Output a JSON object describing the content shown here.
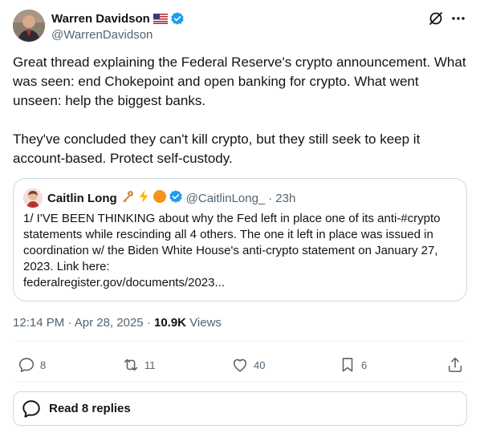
{
  "post": {
    "author_name": "Warren Davidson",
    "author_flag": "🇺🇸",
    "author_handle": "@WarrenDavidson",
    "paragraph_1": "Great thread explaining the Federal Reserve's crypto announcement. What was seen: end Chokepoint and open banking for crypto. What went unseen: help the biggest banks.",
    "paragraph_2": "They've concluded they can't kill crypto, but they still seek to keep it account-based. Protect self-custody.",
    "time": "12:14 PM",
    "date": "Apr 28, 2025",
    "views_count": "10.9K",
    "views_label": "Views"
  },
  "quote": {
    "author_name": "Caitlin Long",
    "author_handle": "@CaitlinLong_",
    "age": "23h",
    "text": "1/ I'VE BEEN THINKING about why the Fed left in place one of its anti-#crypto statements while rescinding all 4 others. The one it left in place was issued in coordination w/ the Biden White House's anti-crypto statement on January 27, 2023. Link here:",
    "link": "federalregister.gov/documents/2023..."
  },
  "actions": {
    "replies": "8",
    "reposts": "11",
    "likes": "40",
    "bookmarks": "6"
  },
  "replies_button": {
    "label": "Read 8 replies"
  },
  "colors": {
    "text": "#0f1419",
    "muted": "#536471",
    "verified": "#1d9bf0",
    "border": "#cfd9de"
  },
  "icons": [
    "verified-badge-icon",
    "grok-icon",
    "more-icon",
    "reply-icon",
    "repost-icon",
    "like-icon",
    "bookmark-icon",
    "share-icon",
    "replies-bubble-icon",
    "key-icon",
    "lightning-icon",
    "orange-circle-icon"
  ]
}
